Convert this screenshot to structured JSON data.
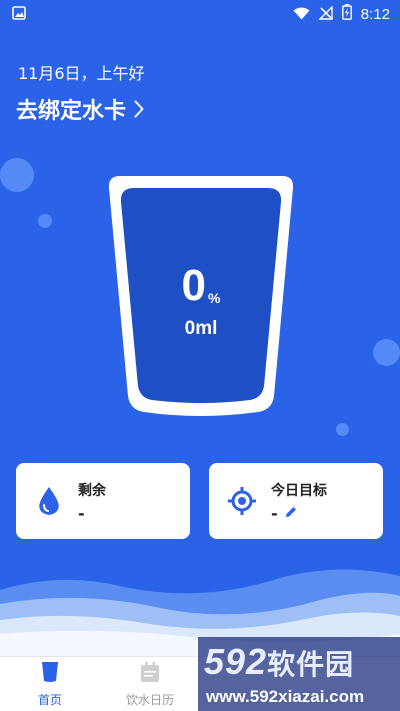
{
  "status_bar": {
    "time": "8:12",
    "icons": [
      "image-icon",
      "wifi-icon",
      "no-signal-icon",
      "battery-charging-icon"
    ]
  },
  "header": {
    "greeting": "11月6日，上午好",
    "bind_card_label": "去绑定水卡"
  },
  "cup": {
    "percent": "0",
    "percent_unit": "%",
    "amount": "0ml",
    "fill_fraction": 0
  },
  "cards": {
    "remaining": {
      "title": "剩余",
      "value": "-",
      "icon": "water-drop-icon"
    },
    "goal": {
      "title": "今日目标",
      "value": "-",
      "icon": "target-icon",
      "edit_icon": "pencil-icon"
    }
  },
  "bottom_nav": {
    "items": [
      {
        "label": "首页",
        "icon": "cup-icon",
        "active": true
      },
      {
        "label": "饮水日历",
        "icon": "calendar-icon",
        "active": false
      }
    ]
  },
  "watermark": {
    "brand_num": "592",
    "brand_cn": "软件园",
    "url": "www.592xiazai.com"
  },
  "colors": {
    "background": "#2a63e8",
    "cup_fill": "#1e4fc4",
    "accent": "#2a63e8",
    "card_bg": "#ffffff"
  }
}
